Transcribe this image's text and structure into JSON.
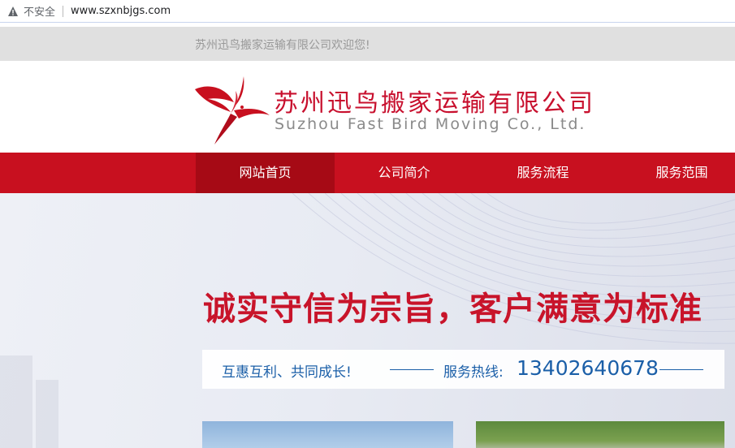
{
  "browser": {
    "security_label": "不安全",
    "url": "www.szxnbjgs.com"
  },
  "topbar": {
    "welcome": "苏州迅鸟搬家运输有限公司欢迎您!"
  },
  "header": {
    "company_cn": "苏州迅鸟搬家运输有限公司",
    "company_en": "Suzhou Fast Bird Moving Co., Ltd.",
    "logo_icon": "bird-logo-icon"
  },
  "nav": {
    "items": [
      {
        "label": "网站首页",
        "active": true
      },
      {
        "label": "公司简介",
        "active": false
      },
      {
        "label": "服务流程",
        "active": false
      },
      {
        "label": "服务范围",
        "active": false
      }
    ]
  },
  "hero": {
    "slogan": "诚实守信为宗旨，客户满意为标准",
    "motto": "互惠互利、共同成长!",
    "hotline_label": "服务热线:",
    "hotline_number": "13402640678"
  },
  "colors": {
    "brand_red": "#c8101f",
    "nav_active": "#a60a15",
    "info_blue": "#1b5fa8"
  }
}
